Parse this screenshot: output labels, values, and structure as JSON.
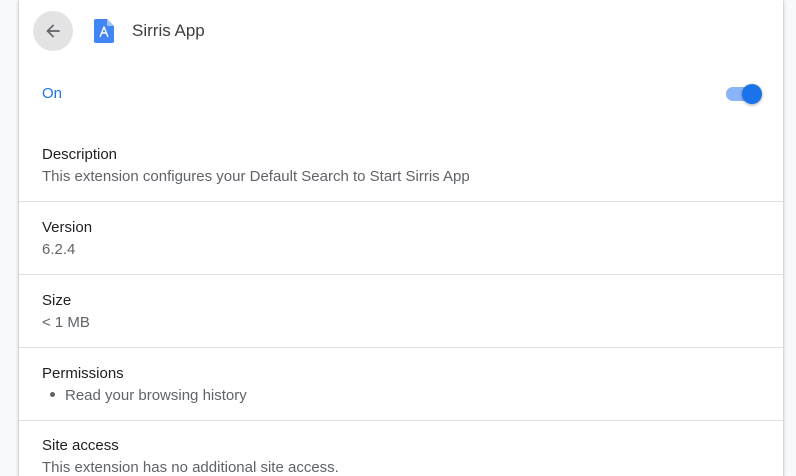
{
  "header": {
    "title": "Sirris App",
    "back_icon": "arrow-back-icon",
    "app_icon": "document-icon"
  },
  "enabled": {
    "label": "On",
    "state": true,
    "accent_color": "#1a73e8"
  },
  "details": {
    "description": {
      "label": "Description",
      "value": "This extension configures your Default Search to Start Sirris App"
    },
    "version": {
      "label": "Version",
      "value": "6.2.4"
    },
    "size": {
      "label": "Size",
      "value": "< 1 MB"
    },
    "permissions": {
      "label": "Permissions",
      "items": [
        "Read your browsing history"
      ]
    },
    "site_access": {
      "label": "Site access",
      "value": "This extension has no additional site access."
    }
  }
}
